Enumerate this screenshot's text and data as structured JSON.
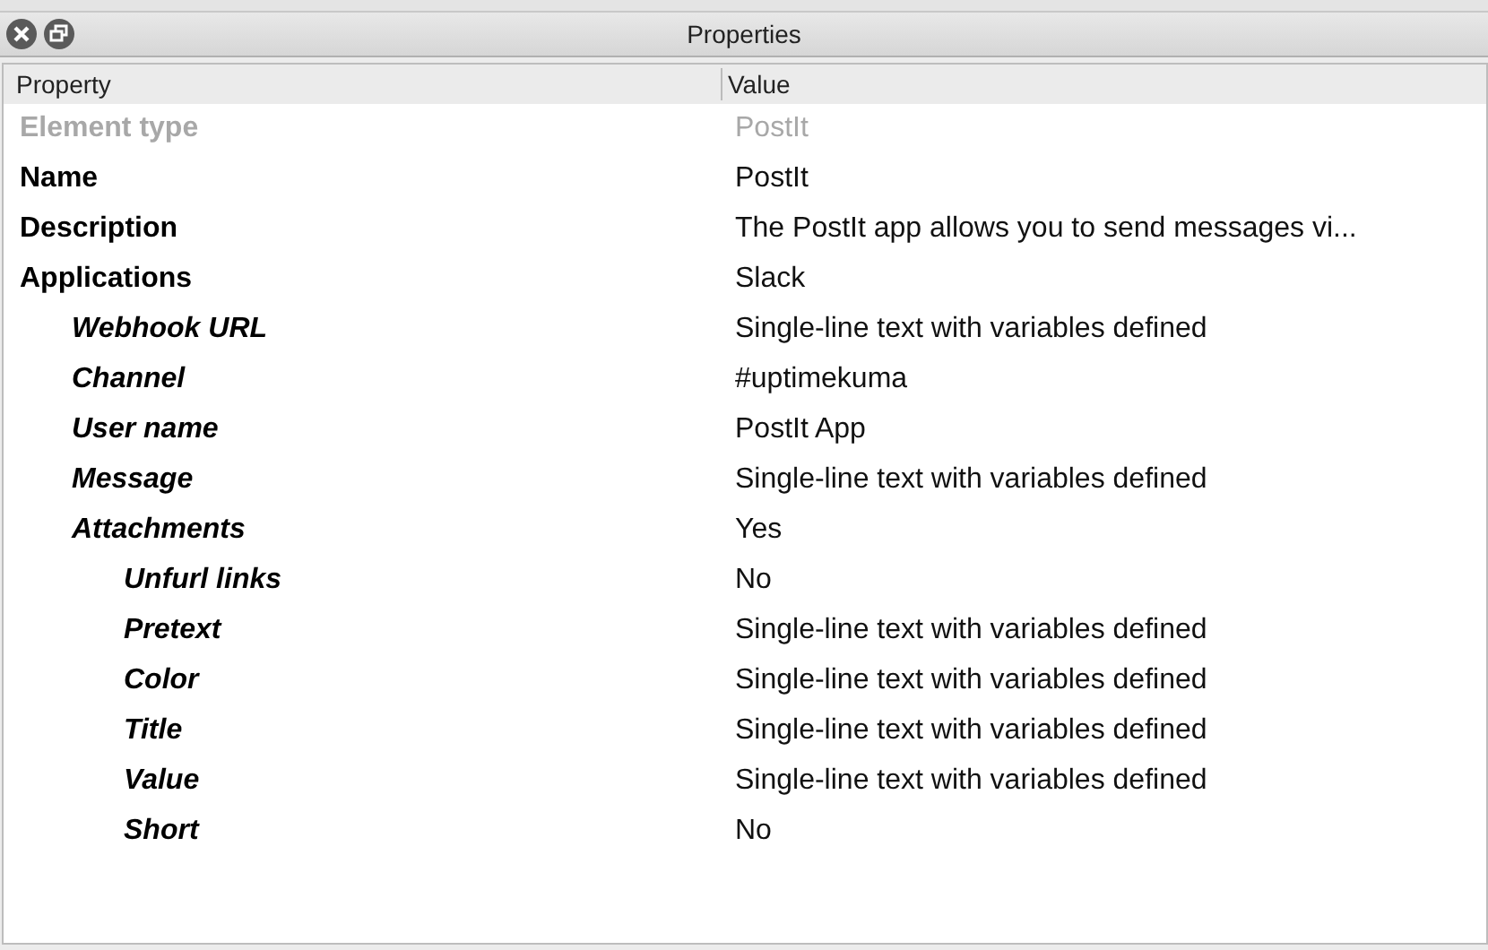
{
  "window": {
    "title": "Properties"
  },
  "table": {
    "columns": [
      "Property",
      "Value"
    ],
    "rows": [
      {
        "property": "Element type",
        "value": "PostIt",
        "disabled": true
      },
      {
        "property": "Name",
        "value": "PostIt",
        "disabled": false
      },
      {
        "property": "Description",
        "value": "The PostIt app allows you to send messages vi...",
        "disabled": false
      },
      {
        "property": "Applications",
        "value": "Slack",
        "disabled": false,
        "children": [
          {
            "property": "Webhook URL",
            "value": "Single-line text with variables defined",
            "disabled": false
          },
          {
            "property": "Channel",
            "value": "#uptimekuma",
            "disabled": false
          },
          {
            "property": "User name",
            "value": "PostIt App",
            "disabled": false
          },
          {
            "property": "Message",
            "value": "Single-line text with variables defined",
            "disabled": false
          },
          {
            "property": "Attachments",
            "value": "Yes",
            "disabled": false,
            "children": [
              {
                "property": "Unfurl links",
                "value": "No",
                "disabled": false
              },
              {
                "property": "Pretext",
                "value": "Single-line text with variables defined",
                "disabled": false
              },
              {
                "property": "Color",
                "value": "Single-line text with variables defined",
                "disabled": false
              },
              {
                "property": "Title",
                "value": "Single-line text with variables defined",
                "disabled": false
              },
              {
                "property": "Value",
                "value": "Single-line text with variables defined",
                "disabled": false
              },
              {
                "property": "Short",
                "value": "No",
                "disabled": false
              }
            ]
          }
        ]
      }
    ]
  }
}
